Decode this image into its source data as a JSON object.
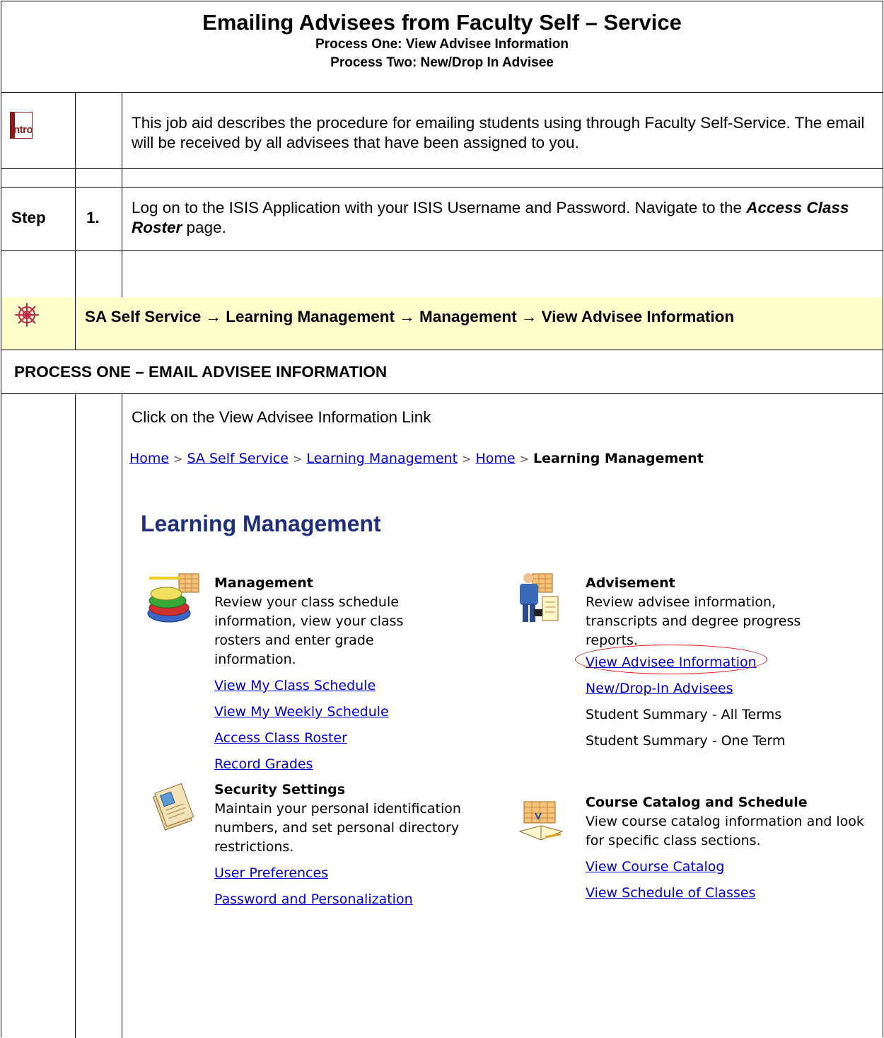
{
  "header": {
    "title": "Emailing Advisees from Faculty Self – Service",
    "subtitle1": "Process One: View Advisee Information",
    "subtitle2": "Process Two: New/Drop In Advisee"
  },
  "intro": {
    "icon_label": "ntro",
    "icon_letter": "I",
    "text": "This job aid describes the procedure for emailing students using through Faculty Self-Service.  The email will be received by all advisees that have been assigned to you."
  },
  "step": {
    "label": "Step",
    "number": "1.",
    "text_before": "Log on to the ISIS Application with your ISIS Username and Password.  Navigate to the ",
    "text_bold": "Access Class Roster",
    "text_after": " page."
  },
  "navigation": {
    "path": "SA Self Service → Learning Management → Management → View Advisee Information",
    "icon": "ship-wheel-icon",
    "bg_color": "#ffffcc"
  },
  "process_one": {
    "heading": "PROCESS ONE – EMAIL ADVISEE INFORMATION",
    "instruction": "Click on the View Advisee Information Link"
  },
  "screenshot": {
    "breadcrumbs": [
      "Home",
      "SA Self Service",
      "Learning Management",
      "Home"
    ],
    "breadcrumb_current": "Learning Management",
    "breadcrumb_separator": ">",
    "page_title": "Learning Management",
    "link_color": "#0000cc",
    "title_color": "#1f2f7a",
    "management": {
      "title": "Management",
      "description": "Review your class schedule information, view your class rosters and enter grade information.",
      "links": [
        "View My Class Schedule",
        "View My Weekly Schedule",
        "Access Class Roster",
        "Record Grades"
      ]
    },
    "advisement": {
      "title": "Advisement",
      "description": "Review advisee information, transcripts and degree progress reports.",
      "links": [
        "View Advisee Information",
        "New/Drop-In Advisees"
      ],
      "plain_items": [
        "Student Summary - All Terms",
        "Student Summary - One Term"
      ],
      "highlight_color": "#e01010"
    },
    "security": {
      "title": "Security Settings",
      "description": "Maintain your personal identification numbers, and set personal directory restrictions.",
      "links": [
        "User Preferences",
        "Password and Personalization"
      ]
    },
    "catalog": {
      "title": "Course Catalog and Schedule",
      "description": "View course catalog information and look for specific class sections.",
      "links": [
        "View Course Catalog",
        "View Schedule of Classes"
      ]
    }
  }
}
